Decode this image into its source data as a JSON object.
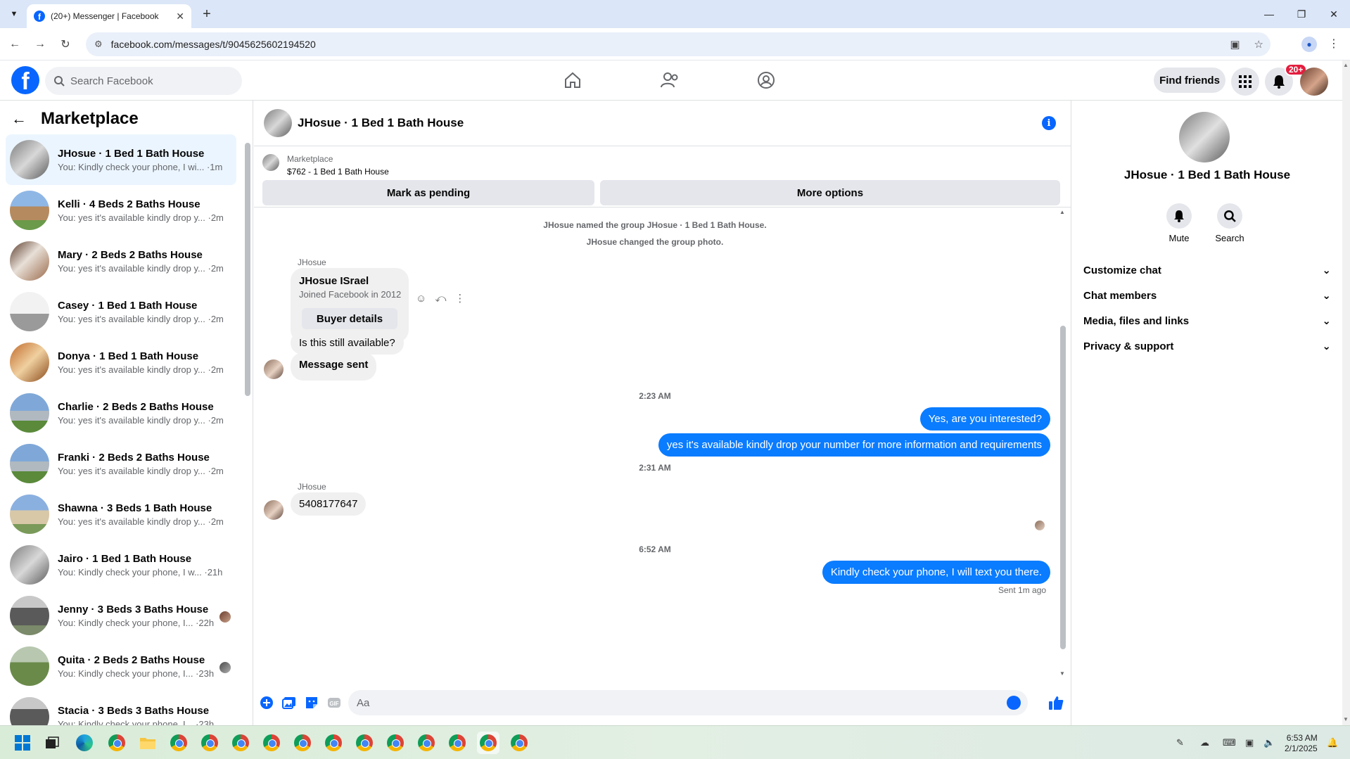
{
  "browser": {
    "tab_title": "(20+) Messenger | Facebook",
    "url": "facebook.com/messages/t/9045625602194520"
  },
  "fb": {
    "search_placeholder": "Search Facebook",
    "find_friends": "Find friends",
    "notif_badge": "20+"
  },
  "left": {
    "title": "Marketplace",
    "conversations": [
      {
        "name": "JHosue · 1 Bed 1 Bath House",
        "last": "You: Kindly check your phone, I wi... ·1m"
      },
      {
        "name": "Kelli · 4 Beds 2 Baths House",
        "last": "You: yes it's available kindly drop y... ·2m"
      },
      {
        "name": "Mary · 2 Beds 2 Baths House",
        "last": "You: yes it's available kindly drop y... ·2m"
      },
      {
        "name": "Casey · 1 Bed 1 Bath House",
        "last": "You: yes it's available kindly drop y... ·2m"
      },
      {
        "name": "Donya · 1 Bed 1 Bath House",
        "last": "You: yes it's available kindly drop y... ·2m"
      },
      {
        "name": "Charlie · 2 Beds 2 Baths House",
        "last": "You: yes it's available kindly drop y... ·2m"
      },
      {
        "name": "Franki · 2 Beds 2 Baths House",
        "last": "You: yes it's available kindly drop y... ·2m"
      },
      {
        "name": "Shawna · 3 Beds 1 Bath House",
        "last": "You: yes it's available kindly drop y... ·2m"
      },
      {
        "name": "Jairo · 1 Bed 1 Bath House",
        "last": "You: Kindly check your phone, I w... ·21h"
      },
      {
        "name": "Jenny · 3 Beds 3 Baths House",
        "last": "You: Kindly check your phone, I... ·22h"
      },
      {
        "name": "Quita · 2 Beds 2 Baths House",
        "last": "You: Kindly check your phone, I... ·23h"
      },
      {
        "name": "Stacia · 3 Beds 3 Baths House",
        "last": "You: Kindly check your phone, I... ·23h"
      }
    ]
  },
  "chat": {
    "title": "JHosue · 1 Bed 1 Bath House",
    "marketplace_label": "Marketplace",
    "listing": "$762 - 1 Bed 1 Bath House",
    "mark_pending": "Mark as pending",
    "more_options": "More options",
    "sys1": "JHosue named the group JHosue · 1 Bed 1 Bath House.",
    "sys2": "JHosue changed the group photo.",
    "sender": "JHosue",
    "card_name": "JHosue ISrael",
    "card_joined": "Joined Facebook in 2012",
    "buyer_details": "Buyer details",
    "msg_available": "Is this still available?",
    "msg_sent": "Message sent",
    "ts1": "2:23 AM",
    "out1": "Yes, are you interested?",
    "out2": "yes it's available kindly drop your number for more information and requirements",
    "ts2": "2:31 AM",
    "phone": "5408177647",
    "ts3": "6:52 AM",
    "out3": "Kindly check your phone, I will text you there.",
    "sent_ago": "Sent 1m ago",
    "composer_placeholder": "Aa"
  },
  "right": {
    "name": "JHosue · 1 Bed 1 Bath House",
    "mute": "Mute",
    "search": "Search",
    "sections": [
      "Customize chat",
      "Chat members",
      "Media, files and links",
      "Privacy & support"
    ]
  },
  "taskbar": {
    "time": "6:53 AM",
    "date": "2/1/2025"
  }
}
